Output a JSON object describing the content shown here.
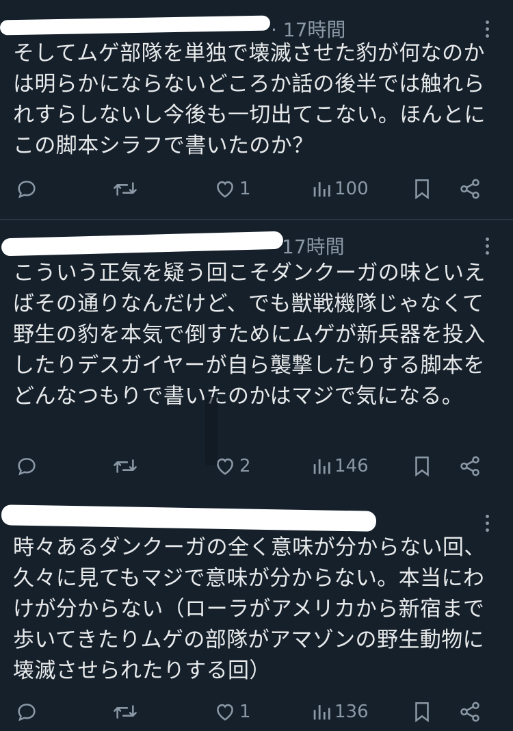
{
  "posts": [
    {
      "time": "· 17時間",
      "text": "そしてムゲ部隊を単独で壊滅させた豹が何なのかは明らかにならないどころか話の後半では触れられすらしないし今後も一切出てこない。ほんとにこの脚本シラフで書いたのか？",
      "likes": "1",
      "views": "100"
    },
    {
      "time": "17時間",
      "text": "こういう正気を疑う回こそダンクーガの味といえばその通りなんだけど、でも獣戦機隊じゃなくて野生の豹を本気で倒すためにムゲが新兵器を投入したりデスガイヤーが自ら襲撃したりする脚本をどんなつもりで書いたのかはマジで気になる。",
      "likes": "2",
      "views": "146"
    },
    {
      "time": "",
      "text": "時々あるダンクーガの全く意味が分からない回、久々に見てもマジで意味が分からない。本当にわけが分からない（ローラがアメリカから新宿まで歩いてきたりムゲの部隊がアマゾンの野生動物に壊滅させられたりする回）",
      "likes": "1",
      "views": "136"
    }
  ],
  "icons": {
    "reply": "reply-icon",
    "retweet": "retweet-icon",
    "like": "heart-icon",
    "views": "views-icon",
    "bookmark": "bookmark-icon",
    "share": "share-icon",
    "more": "more-icon"
  },
  "colors": {
    "background": "#15202b",
    "text": "#e7e9ea",
    "muted": "#8b98a5"
  }
}
